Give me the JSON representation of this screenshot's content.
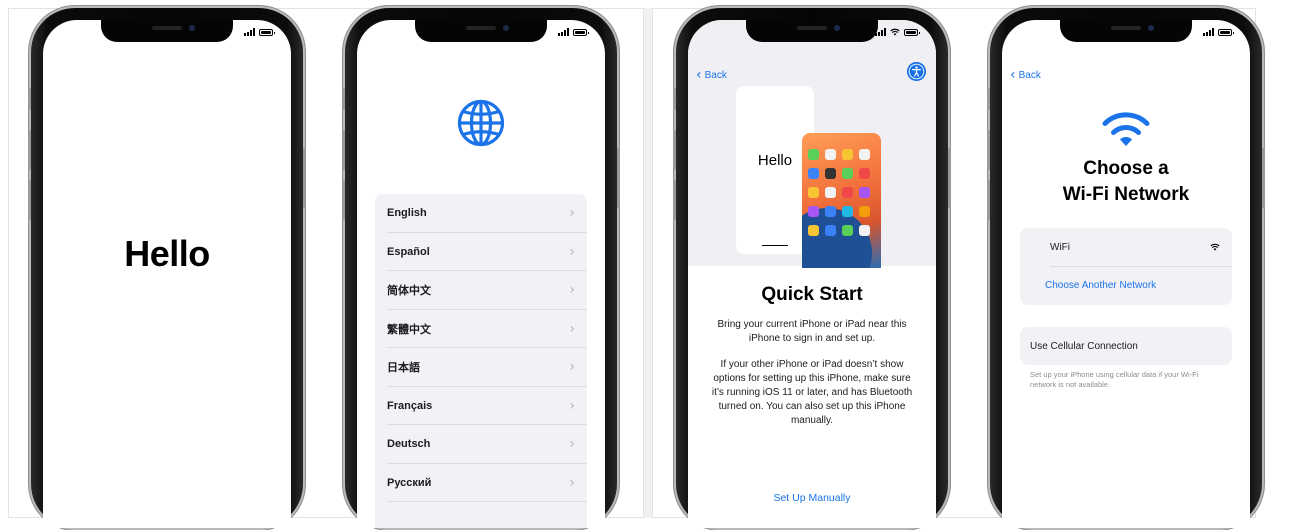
{
  "colors": {
    "ios_blue": "#1a73e8",
    "list_bg": "#f1f1f6",
    "separator": "#dcdce0",
    "secondary_text": "#8e8e93"
  },
  "screen1": {
    "title": "Hello"
  },
  "screen2": {
    "icon": "globe-icon",
    "languages": [
      {
        "label": "English"
      },
      {
        "label": "Español"
      },
      {
        "label": "简体中文"
      },
      {
        "label": "繁體中文"
      },
      {
        "label": "日本語"
      },
      {
        "label": "Français"
      },
      {
        "label": "Deutsch"
      },
      {
        "label": "Русский"
      }
    ],
    "chevron": "›"
  },
  "screen3": {
    "back_label": "Back",
    "preview_text": "Hello",
    "title": "Quick Start",
    "paragraph1": "Bring your current iPhone or iPad near this iPhone to sign in and set up.",
    "paragraph2": "If your other iPhone or iPad doesn’t show options for setting up this iPhone, make sure it’s running iOS 11 or later, and has Bluetooth turned on. You can also set up this iPhone manually.",
    "setup_manually": "Set Up Manually"
  },
  "screen4": {
    "back_label": "Back",
    "title_line1": "Choose a",
    "title_line2": "Wi-Fi Network",
    "network_name": "WiFi",
    "choose_another": "Choose Another Network",
    "cellular": "Use Cellular Connection",
    "cellular_note": "Set up your iPhone using cellular data if your Wi-Fi network is not available."
  }
}
